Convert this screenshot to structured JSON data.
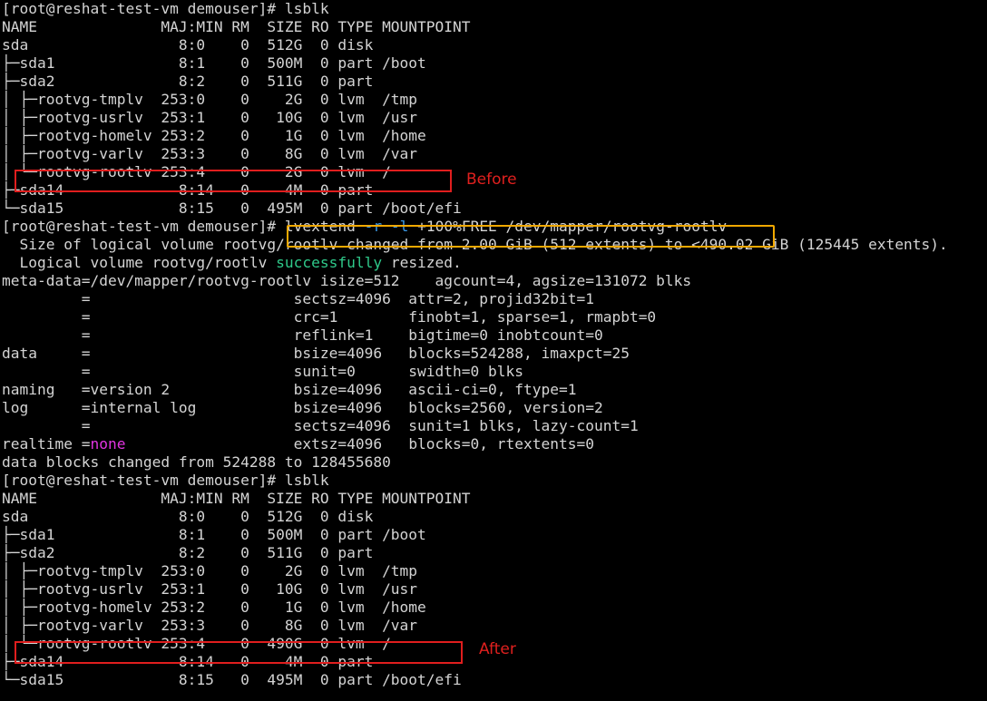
{
  "terminal": {
    "lines": [
      "[root@reshat-test-vm demouser]# lsblk",
      "NAME              MAJ:MIN RM  SIZE RO TYPE MOUNTPOINT",
      "sda                 8:0    0  512G  0 disk",
      "├─sda1              8:1    0  500M  0 part /boot",
      "├─sda2              8:2    0  511G  0 part",
      "│ ├─rootvg-tmplv  253:0    0    2G  0 lvm  /tmp",
      "│ ├─rootvg-usrlv  253:1    0   10G  0 lvm  /usr",
      "│ ├─rootvg-homelv 253:2    0    1G  0 lvm  /home",
      "│ ├─rootvg-varlv  253:3    0    8G  0 lvm  /var",
      "│ └─rootvg-rootlv 253:4    0    2G  0 lvm  /",
      "├─sda14             8:14   0    4M  0 part",
      "└─sda15             8:15   0  495M  0 part /boot/efi",
      "",
      "  Size of logical volume rootvg/rootlv changed from 2.00 GiB (512 extents) to <490.02 GiB (125445 extents).",
      "",
      "meta-data=/dev/mapper/rootvg-rootlv isize=512    agcount=4, agsize=131072 blks",
      "         =                       sectsz=4096  attr=2, projid32bit=1",
      "         =                       crc=1        finobt=1, sparse=1, rmapbt=0",
      "         =                       reflink=1    bigtime=0 inobtcount=0",
      "data     =                       bsize=4096   blocks=524288, imaxpct=25",
      "         =                       sunit=0      swidth=0 blks",
      "naming   =version 2              bsize=4096   ascii-ci=0, ftype=1",
      "log      =internal log           bsize=4096   blocks=2560, version=2",
      "         =                       sectsz=4096  sunit=1 blks, lazy-count=1",
      "",
      "data blocks changed from 524288 to 128455680",
      "[root@reshat-test-vm demouser]# lsblk",
      "NAME              MAJ:MIN RM  SIZE RO TYPE MOUNTPOINT",
      "sda                 8:0    0  512G  0 disk",
      "├─sda1              8:1    0  500M  0 part /boot",
      "├─sda2              8:2    0  511G  0 part",
      "│ ├─rootvg-tmplv  253:0    0    2G  0 lvm  /tmp",
      "│ ├─rootvg-usrlv  253:1    0   10G  0 lvm  /usr",
      "│ ├─rootvg-homelv 253:2    0    1G  0 lvm  /home",
      "│ ├─rootvg-varlv  253:3    0    8G  0 lvm  /var",
      "│ └─rootvg-rootlv 253:4    0  490G  0 lvm  /",
      "├─sda14             8:14   0    4M  0 part",
      "└─sda15             8:15   0  495M  0 part /boot/efi"
    ],
    "line12": {
      "prompt": "[root@reshat-test-vm demouser]# ",
      "cmd": "lvextend",
      "opt_r": "-r",
      "opt_l": "-l",
      "arg": "+100%FREE /dev/mapper/rootvg-rootlv"
    },
    "line14": {
      "pre": "  Logical volume rootvg/rootlv ",
      "word": "successfully",
      "post": " resized."
    },
    "line24": {
      "pre": "realtime =",
      "word": "none",
      "post": "                   extsz=4096   blocks=0, rtextents=0"
    }
  },
  "annotations": {
    "before_label": "Before",
    "after_label": "After"
  },
  "colors": {
    "background": "#000000",
    "text": "#d4d4d4",
    "option_flag": "#3b9ae8",
    "success": "#2fc98a",
    "none_value": "#e034e0",
    "red_box": "#e01e1e",
    "yellow_box": "#f0a800"
  }
}
